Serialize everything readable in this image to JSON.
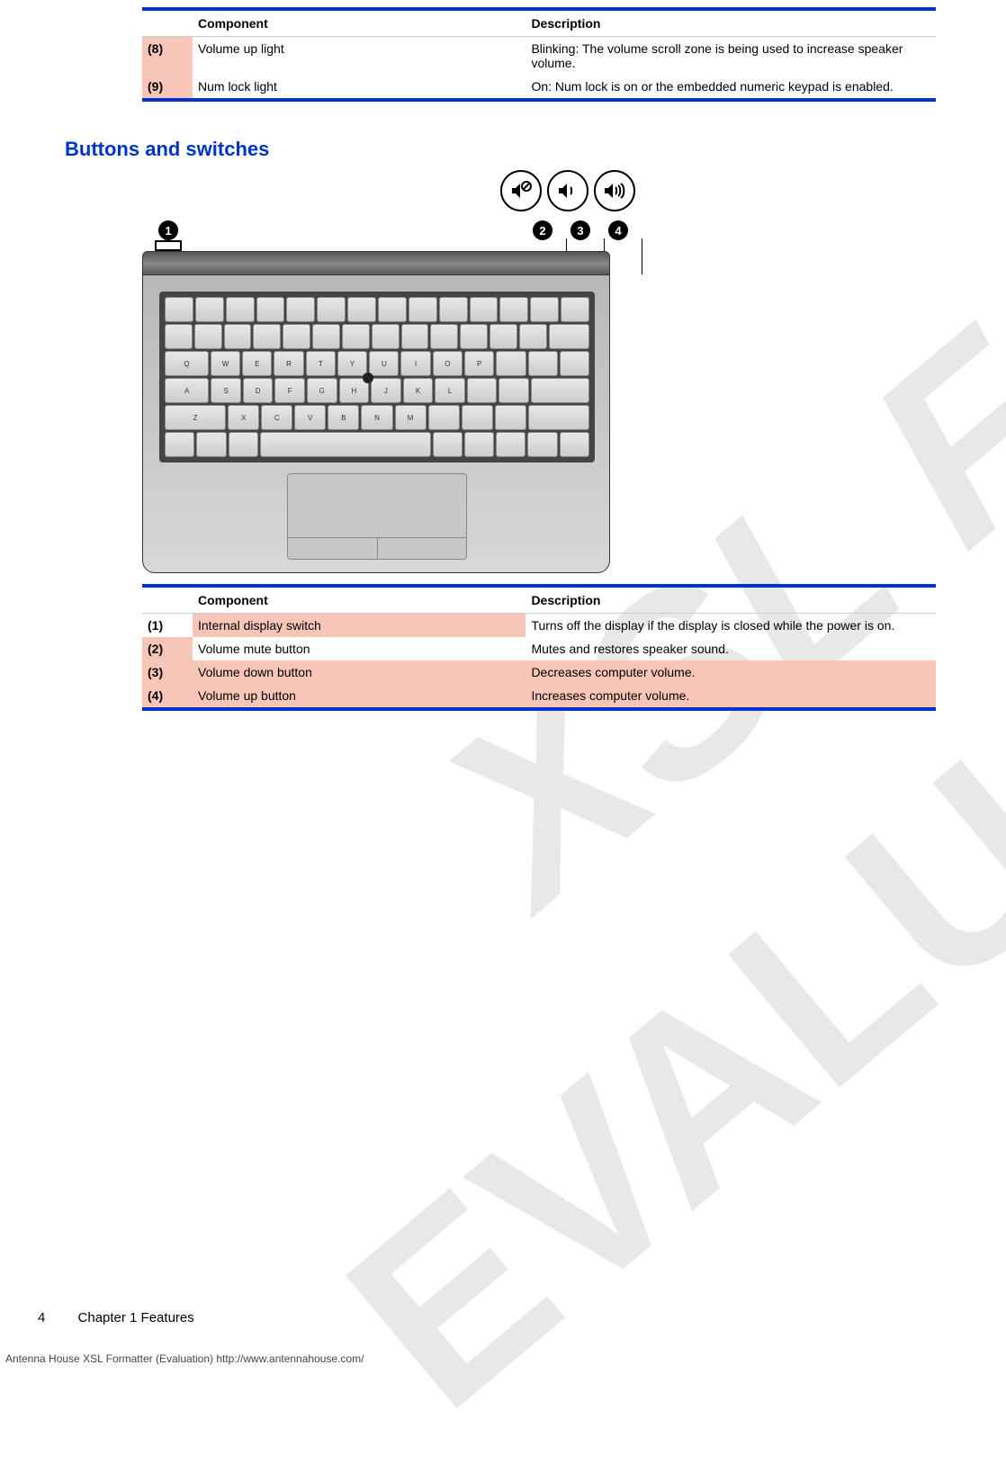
{
  "watermarks": {
    "line1": "XSL Formatter",
    "line2": "EVALUATION"
  },
  "table1": {
    "headers": {
      "component": "Component",
      "description": "Description"
    },
    "rows": [
      {
        "num": "(8)",
        "component": "Volume up light",
        "description": "Blinking: The volume scroll zone is being used to increase speaker volume."
      },
      {
        "num": "(9)",
        "component": "Num lock light",
        "description": "On: Num lock is on or the embedded numeric keypad is enabled."
      }
    ]
  },
  "section_heading": "Buttons and switches",
  "callouts": {
    "n1": "1",
    "n2": "2",
    "n3": "3",
    "n4": "4"
  },
  "table2": {
    "headers": {
      "component": "Component",
      "description": "Description"
    },
    "rows": [
      {
        "num": "(1)",
        "component": "Internal display switch",
        "description": "Turns off the display if the display is closed while the power is on."
      },
      {
        "num": "(2)",
        "component": "Volume mute button",
        "description": "Mutes and restores speaker sound."
      },
      {
        "num": "(3)",
        "component": "Volume down button",
        "description": "Decreases computer volume."
      },
      {
        "num": "(4)",
        "component": "Volume up button",
        "description": "Increases computer volume."
      }
    ]
  },
  "footer": {
    "page_number": "4",
    "chapter": "Chapter 1   Features"
  },
  "eval_footer": "Antenna House XSL Formatter (Evaluation)  http://www.antennahouse.com/"
}
